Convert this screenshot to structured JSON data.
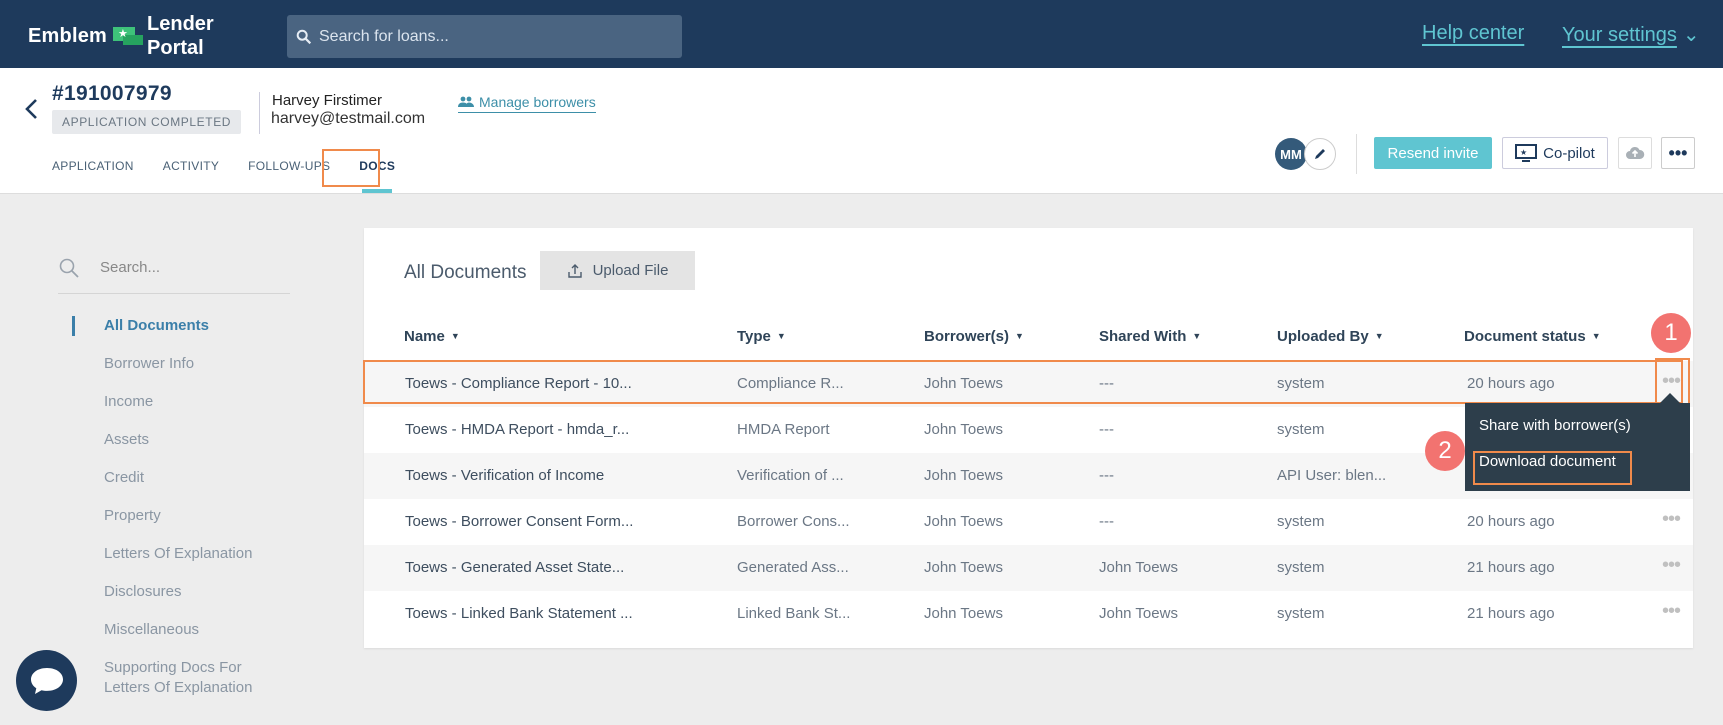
{
  "topbar": {
    "logo_left": "Emblem",
    "logo_right_top": "Lender",
    "logo_right_bottom": "Portal",
    "search_placeholder": "Search for loans...",
    "help_link": "Help center",
    "settings_link": "Your settings",
    "settings_caret": "⌄"
  },
  "header": {
    "loan_number": "#191007979",
    "status": "APPLICATION COMPLETED",
    "borrower_name": "Harvey Firstimer",
    "borrower_email": "harvey@testmail.com",
    "manage_borrowers": "Manage borrowers",
    "tabs": [
      {
        "label": "APPLICATION"
      },
      {
        "label": "ACTIVITY"
      },
      {
        "label": "FOLLOW-UPS"
      },
      {
        "label": "DOCS",
        "active": true
      }
    ],
    "avatar_initials": "MM",
    "resend_invite": "Resend invite",
    "copilot": "Co-pilot",
    "more": "•••"
  },
  "sidebar": {
    "search_placeholder": "Search...",
    "items": [
      {
        "label": "All Documents",
        "active": true
      },
      {
        "label": "Borrower Info"
      },
      {
        "label": "Income"
      },
      {
        "label": "Assets"
      },
      {
        "label": "Credit"
      },
      {
        "label": "Property"
      },
      {
        "label": "Letters Of Explanation"
      },
      {
        "label": "Disclosures"
      },
      {
        "label": "Miscellaneous"
      },
      {
        "label": "Supporting Docs For Letters Of Explanation"
      }
    ]
  },
  "docs": {
    "title": "All Documents",
    "upload_label": "Upload File",
    "columns": [
      "Name",
      "Type",
      "Borrower(s)",
      "Shared With",
      "Uploaded By",
      "Document status"
    ],
    "caret": "▼",
    "rows": [
      {
        "name": "Toews - Compliance Report - 10...",
        "type": "Compliance R...",
        "borrower": "John Toews",
        "shared": "---",
        "uploaded_by": "system",
        "status": "20 hours ago"
      },
      {
        "name": "Toews - HMDA Report - hmda_r...",
        "type": "HMDA Report",
        "borrower": "John Toews",
        "shared": "---",
        "uploaded_by": "system",
        "status": ""
      },
      {
        "name": "Toews - Verification of Income",
        "type": "Verification of ...",
        "borrower": "John Toews",
        "shared": "---",
        "uploaded_by": "API User: blen...",
        "status": ""
      },
      {
        "name": "Toews - Borrower Consent Form...",
        "type": "Borrower Cons...",
        "borrower": "John Toews",
        "shared": "---",
        "uploaded_by": "system",
        "status": "20 hours ago"
      },
      {
        "name": "Toews - Generated Asset State...",
        "type": "Generated Ass...",
        "borrower": "John Toews",
        "shared": "John Toews",
        "uploaded_by": "system",
        "status": "21 hours ago"
      },
      {
        "name": "Toews - Linked Bank Statement ...",
        "type": "Linked Bank St...",
        "borrower": "John Toews",
        "shared": "John Toews",
        "uploaded_by": "system",
        "status": "21 hours ago"
      }
    ],
    "row_more": "•••",
    "menu": {
      "share": "Share with borrower(s)",
      "download": "Download document"
    }
  },
  "callouts": {
    "one": "1",
    "two": "2"
  },
  "colors": {
    "navy": "#1e3a5c",
    "accent_teal": "#5fc5d1",
    "highlight_orange": "#f08a4b",
    "callout_red": "#f27370"
  }
}
